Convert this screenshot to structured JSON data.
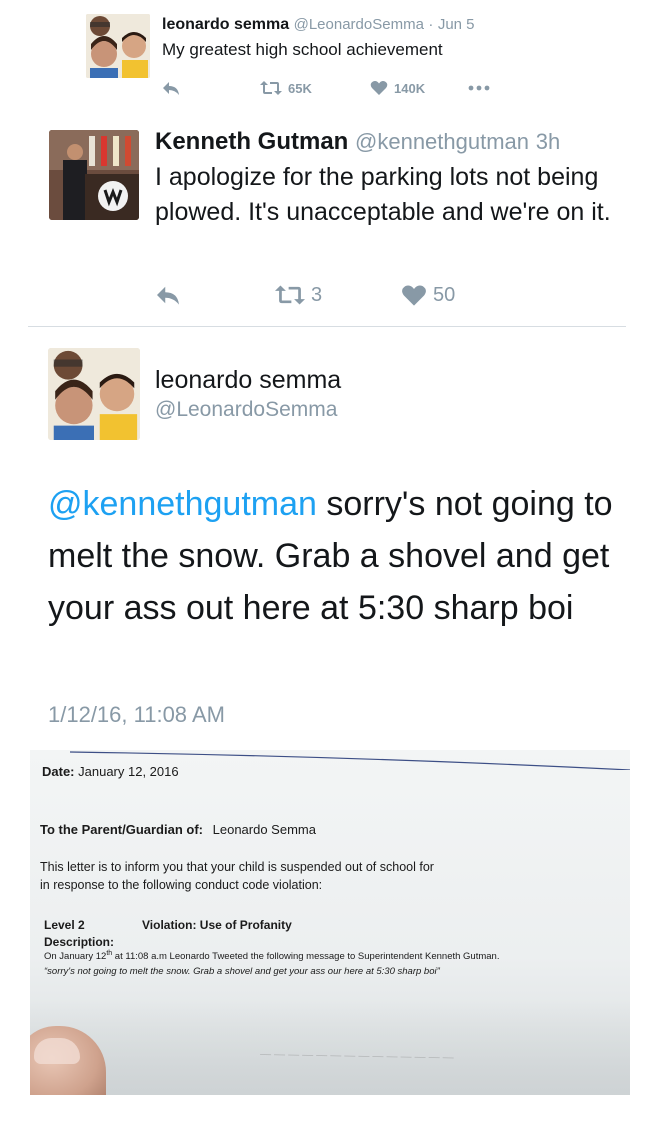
{
  "tweet1": {
    "name": "leonardo semma",
    "handle": "@LeonardoSemma",
    "date": "Jun 5",
    "text": "My greatest high school achievement",
    "retweets": "65K",
    "likes": "140K"
  },
  "tweet2": {
    "name": "Kenneth Gutman",
    "handle": "@kennethgutman",
    "time": "3h",
    "text": "I apologize for the parking lots not being plowed. It's unacceptable and we're on it.",
    "retweets": "3",
    "likes": "50"
  },
  "tweet3": {
    "name": "leonardo semma",
    "handle": "@LeonardoSemma",
    "mention": "@kennethgutman",
    "text": " sorry's not going to melt the snow. Grab a shovel and get your ass out here at 5:30 sharp boi",
    "timestamp": "1/12/16, 11:08 AM"
  },
  "letter": {
    "date_label": "Date:",
    "date_value": "January 12, 2016",
    "to_label": "To the Parent/Guardian of:",
    "to_value": "Leonardo Semma",
    "inform_line1": "This letter is to inform you that your child is suspended out of school for",
    "inform_line2": "in response to the following conduct code violation:",
    "level": "Level 2",
    "violation": "Violation: Use of Profanity",
    "description_label": "Description:",
    "desc_pre": "On January 12",
    "desc_sup": "th",
    "desc_post": " at 11:08 a.m Leonardo Tweeted the following message to Superintendent Kenneth Gutman.",
    "quote": "“sorry's not going to melt the snow.  Grab a shovel and get your ass our here at 5:30 sharp boi”"
  },
  "colors": {
    "text": "#14171a",
    "muted": "#8899a6",
    "link": "#1da1f2",
    "divider": "#d7dde2"
  }
}
